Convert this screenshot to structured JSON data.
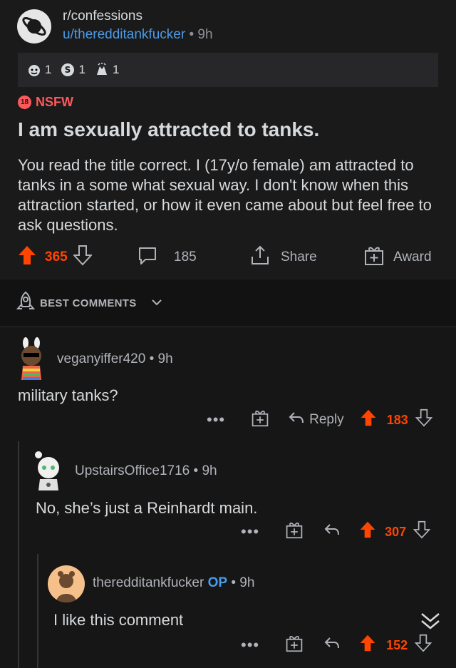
{
  "post": {
    "subreddit": "r/confessions",
    "author": "u/theredditankfucker",
    "age": "9h",
    "awards": [
      {
        "icon": "award-face-icon",
        "count": "1"
      },
      {
        "icon": "award-coin-icon",
        "count": "1"
      },
      {
        "icon": "award-hands-icon",
        "count": "1"
      }
    ],
    "nsfw_badge": "18",
    "nsfw_label": "NSFW",
    "title": "I am sexually attracted to tanks.",
    "body": "You read the title correct. I (17y/o female) am attracted to tanks in a some what sexual way. I don't know when this attraction started, or how it even came about but feel free to ask questions.",
    "votes": "365",
    "comments": "185",
    "share_label": "Share",
    "award_label": "Award"
  },
  "sort": {
    "label": "BEST COMMENTS"
  },
  "comments": [
    {
      "user": "veganyiffer420",
      "age": "9h",
      "text": "military tanks?",
      "reply_label": "Reply",
      "votes": "183"
    },
    {
      "user": "UpstairsOffice1716",
      "age": "9h",
      "text": "No, she’s just a Reinhardt main.",
      "votes": "307"
    },
    {
      "user": "theredditankfucker",
      "op_label": "OP",
      "age": "9h",
      "text": "I like this comment",
      "votes": "152"
    }
  ],
  "sep": "•",
  "colors": {
    "upvote": "#ff4500",
    "link": "#4a9be8",
    "nsfw": "#ff585b",
    "background": "#1a1a1b"
  }
}
